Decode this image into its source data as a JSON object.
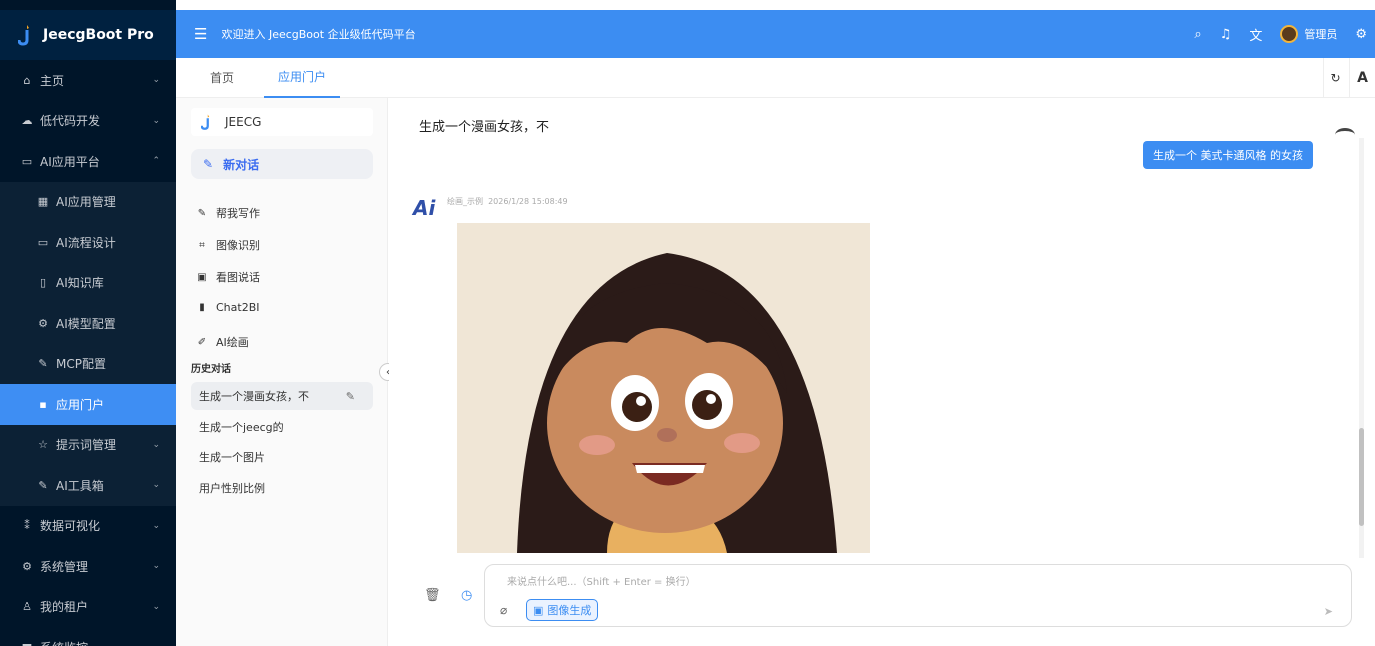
{
  "app": {
    "title": "JeecgBoot Pro"
  },
  "header": {
    "welcome": "欢迎进入 JeecgBoot 企业级低代码平台",
    "user": "管理员"
  },
  "sidebar": {
    "items": [
      {
        "label": "主页",
        "icon": "home-icon",
        "glyph": "⌂",
        "arrow": "⌄",
        "type": "top"
      },
      {
        "label": "低代码开发",
        "icon": "cloud-icon",
        "glyph": "☁",
        "arrow": "⌄",
        "type": "top"
      },
      {
        "label": "AI应用平台",
        "icon": "ai-icon",
        "glyph": "▭",
        "arrow": "⌃",
        "type": "top"
      },
      {
        "label": "AI应用管理",
        "icon": "grid-icon",
        "glyph": "▦",
        "arrow": "",
        "type": "sub"
      },
      {
        "label": "AI流程设计",
        "icon": "flow-icon",
        "glyph": "▭",
        "arrow": "",
        "type": "sub"
      },
      {
        "label": "AI知识库",
        "icon": "book-icon",
        "glyph": "▯",
        "arrow": "",
        "type": "sub"
      },
      {
        "label": "AI模型配置",
        "icon": "settings-icon",
        "glyph": "⚙",
        "arrow": "",
        "type": "sub"
      },
      {
        "label": "MCP配置",
        "icon": "tool-icon",
        "glyph": "✎",
        "arrow": "",
        "type": "sub"
      },
      {
        "label": "应用门户",
        "icon": "apps-icon",
        "glyph": "▪",
        "arrow": "",
        "type": "active"
      },
      {
        "label": "提示词管理",
        "icon": "star-icon",
        "glyph": "☆",
        "arrow": "⌄",
        "type": "sub"
      },
      {
        "label": "AI工具箱",
        "icon": "tool-icon",
        "glyph": "✎",
        "arrow": "⌄",
        "type": "sub"
      },
      {
        "label": "数据可视化",
        "icon": "chart-icon",
        "glyph": "⁑",
        "arrow": "⌄",
        "type": "top"
      },
      {
        "label": "系统管理",
        "icon": "settings-icon",
        "glyph": "⚙",
        "arrow": "⌄",
        "type": "top"
      },
      {
        "label": "我的租户",
        "icon": "user-icon",
        "glyph": "♙",
        "arrow": "⌄",
        "type": "top"
      },
      {
        "label": "系统监控",
        "icon": "monitor-icon",
        "glyph": "▆",
        "arrow": "⌄",
        "type": "top"
      }
    ]
  },
  "tabs": [
    {
      "label": "首页"
    },
    {
      "label": "应用门户"
    }
  ],
  "conv": {
    "brand": "JEECG",
    "new_chat": "新对话",
    "tools": [
      {
        "label": "帮我写作",
        "glyph": "✎"
      },
      {
        "label": "图像识别",
        "glyph": "⌗"
      },
      {
        "label": "看图说话",
        "glyph": "▣"
      },
      {
        "label": "Chat2BI",
        "glyph": "▮"
      },
      {
        "label": "AI绘画",
        "glyph": "✐"
      }
    ],
    "history_title": "历史对话",
    "history": [
      "生成一个漫画女孩，不",
      "生成一个jeecg的",
      "生成一个图片",
      "用户性别比例"
    ]
  },
  "chat": {
    "title": "生成一个漫画女孩，不",
    "user_msg": "生成一个 美式卡通风格 的女孩",
    "ai_name": "绘画_示例",
    "ai_time": "2026/1/28 15:08:49",
    "placeholder": "来说点什么吧...（Shift + Enter = 换行）",
    "gen_label": "图像生成"
  },
  "colors": {
    "primary": "#3c8df2",
    "sidebar": "#001529"
  }
}
